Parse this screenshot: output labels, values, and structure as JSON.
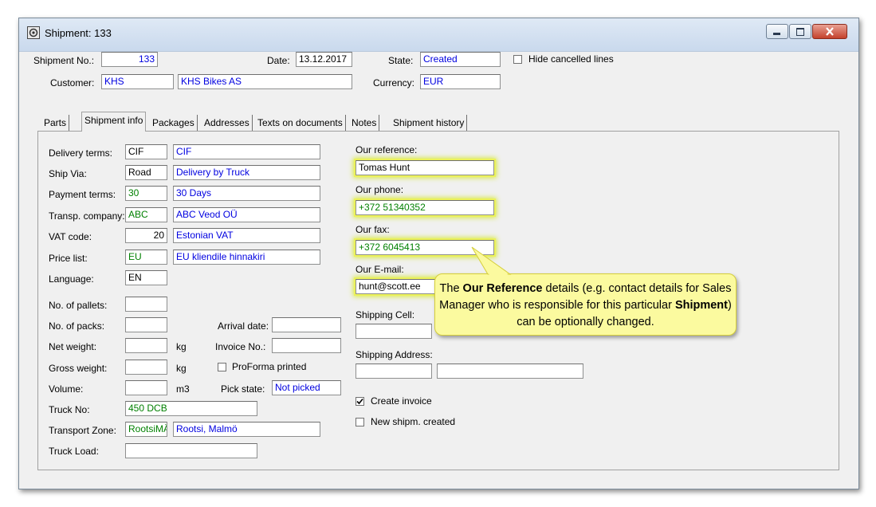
{
  "window": {
    "title": "Shipment: 133"
  },
  "header": {
    "shipment_no_label": "Shipment No.:",
    "shipment_no": "133",
    "date_label": "Date:",
    "date": "13.12.2017",
    "state_label": "State:",
    "state": "Created",
    "hide_cancelled_label": "Hide cancelled lines",
    "customer_label": "Customer:",
    "customer_code": "KHS",
    "customer_name": "KHS Bikes AS",
    "currency_label": "Currency:",
    "currency": "EUR"
  },
  "tabs": [
    {
      "label": "Parts"
    },
    {
      "label": "Shipment info"
    },
    {
      "label": "Packages"
    },
    {
      "label": "Addresses"
    },
    {
      "label": "Texts on documents"
    },
    {
      "label": "Notes"
    },
    {
      "label": "Shipment history"
    }
  ],
  "form": {
    "delivery_terms_label": "Delivery terms:",
    "delivery_terms_code": "CIF",
    "delivery_terms_name": "CIF",
    "ship_via_label": "Ship Via:",
    "ship_via_code": "Road",
    "ship_via_name": "Delivery by Truck",
    "payment_terms_label": "Payment terms:",
    "payment_terms_code": "30",
    "payment_terms_name": "30 Days",
    "transp_company_label": "Transp. company:",
    "transp_company_code": "ABC",
    "transp_company_name": "ABC Veod OÜ",
    "vat_code_label": "VAT code:",
    "vat_code_code": "20",
    "vat_code_name": "Estonian VAT",
    "price_list_label": "Price list:",
    "price_list_code": "EU",
    "price_list_name": "EU kliendile hinnakiri",
    "language_label": "Language:",
    "language_code": "EN",
    "pallets_label": "No. of pallets:",
    "packs_label": "No. of packs:",
    "net_weight_label": "Net weight:",
    "gross_weight_label": "Gross weight:",
    "volume_label": "Volume:",
    "unit_kg": "kg",
    "unit_kg2": "kg",
    "unit_m3": "m3",
    "arrival_date_label": "Arrival date:",
    "invoice_no_label": "Invoice No.:",
    "proforma_label": "ProForma printed",
    "pick_state_label": "Pick state:",
    "pick_state": "Not picked",
    "truck_no_label": "Truck No:",
    "truck_no": "450 DCB",
    "transport_zone_label": "Transport Zone:",
    "transport_zone_code": "RootsiMÄ",
    "transport_zone_name": "Rootsi, Malmö",
    "truck_load_label": "Truck Load:"
  },
  "reference": {
    "our_reference_label": "Our reference:",
    "our_reference": "Tomas Hunt",
    "our_phone_label": "Our phone:",
    "our_phone": "+372 51340352",
    "our_fax_label": "Our fax:",
    "our_fax": "+372 6045413",
    "our_email_label": "Our E-mail:",
    "our_email": "hunt@scott.ee",
    "shipping_cell_label": "Shipping Cell:",
    "shipping_address_label": "Shipping Address:",
    "create_invoice_label": "Create invoice",
    "create_invoice_checked": true,
    "new_shipm_label": "New shipm. created"
  },
  "callout": {
    "part1": "The ",
    "bold1": "Our Reference",
    "part2": " details (e.g. contact details for Sales Manager who is responsible for this particular ",
    "bold2": "Shipment",
    "part3": ") can be optionally changed."
  },
  "colors": {
    "callout_bg": "#fbfa9f",
    "highlight": "#ecf25a",
    "link_blue": "#0000e0",
    "code_green": "#008000"
  }
}
